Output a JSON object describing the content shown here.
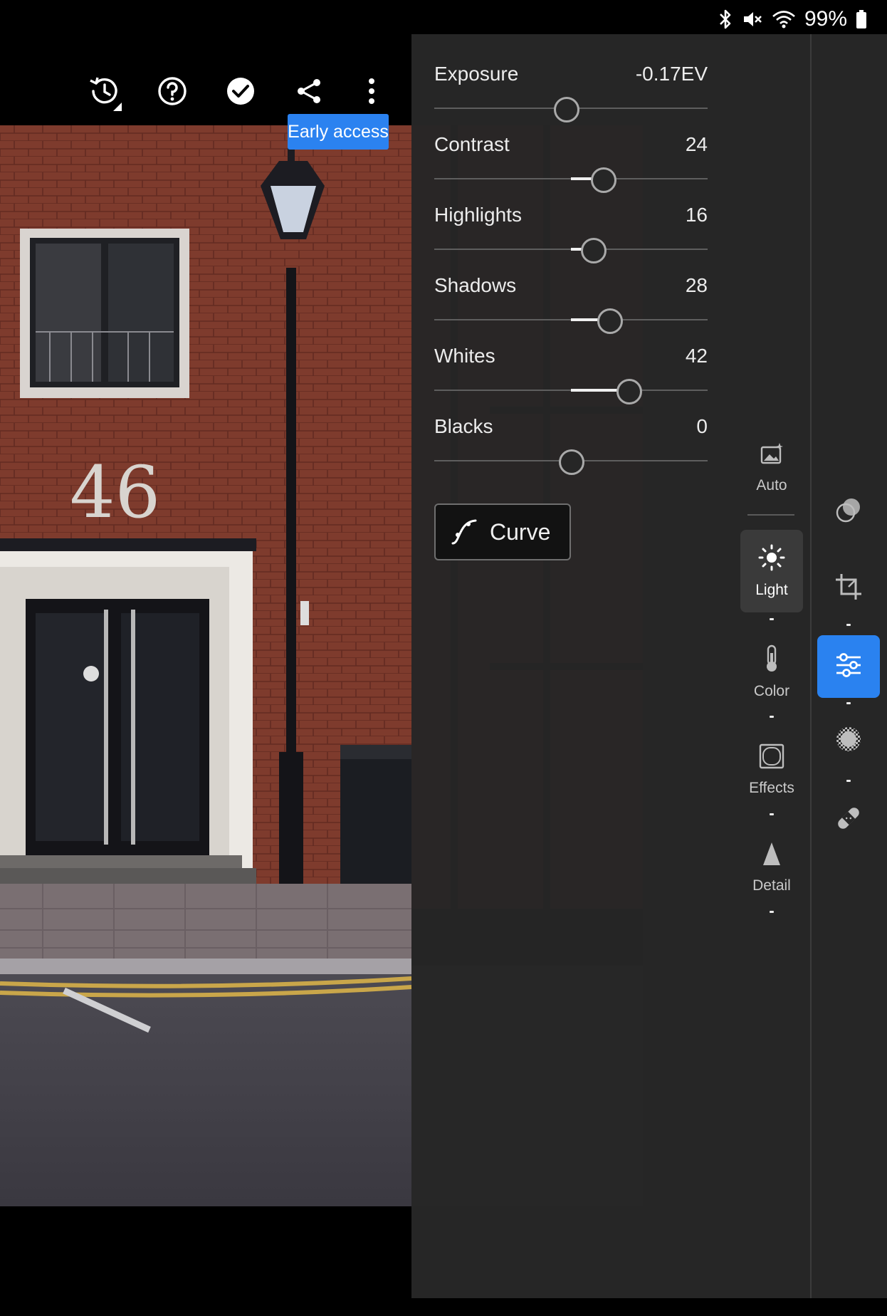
{
  "status": {
    "battery": "99%"
  },
  "topbar": {
    "history": "history-icon",
    "help": "help-icon",
    "done": "checkmark-icon",
    "share": "share-icon",
    "more": "more-vert-icon"
  },
  "badge": {
    "early_access": "Early access"
  },
  "photo": {
    "house_number": "46"
  },
  "light": {
    "sliders": [
      {
        "label": "Exposure",
        "value": "-0.17EV",
        "fraction": 0.483
      },
      {
        "label": "Contrast",
        "value": "24",
        "fraction": 0.617
      },
      {
        "label": "Highlights",
        "value": "16",
        "fraction": 0.58
      },
      {
        "label": "Shadows",
        "value": "28",
        "fraction": 0.64
      },
      {
        "label": "Whites",
        "value": "42",
        "fraction": 0.71
      },
      {
        "label": "Blacks",
        "value": "0",
        "fraction": 0.5
      }
    ],
    "curve_label": "Curve"
  },
  "categories": [
    {
      "label": "Auto",
      "icon": "auto-image-icon"
    },
    {
      "label": "Light",
      "icon": "sun-icon",
      "active": true
    },
    {
      "label": "Color",
      "icon": "thermometer-icon"
    },
    {
      "label": "Effects",
      "icon": "vignette-icon"
    },
    {
      "label": "Detail",
      "icon": "triangle-icon"
    }
  ],
  "tools": [
    {
      "name": "presets",
      "icon": "presets-icon"
    },
    {
      "name": "crop",
      "icon": "crop-icon"
    },
    {
      "name": "edit",
      "icon": "sliders-icon",
      "active": true
    },
    {
      "name": "masking",
      "icon": "masking-icon"
    },
    {
      "name": "healing",
      "icon": "bandage-icon"
    }
  ],
  "colors": {
    "accent": "#2B82F0",
    "panel": "#262626"
  }
}
